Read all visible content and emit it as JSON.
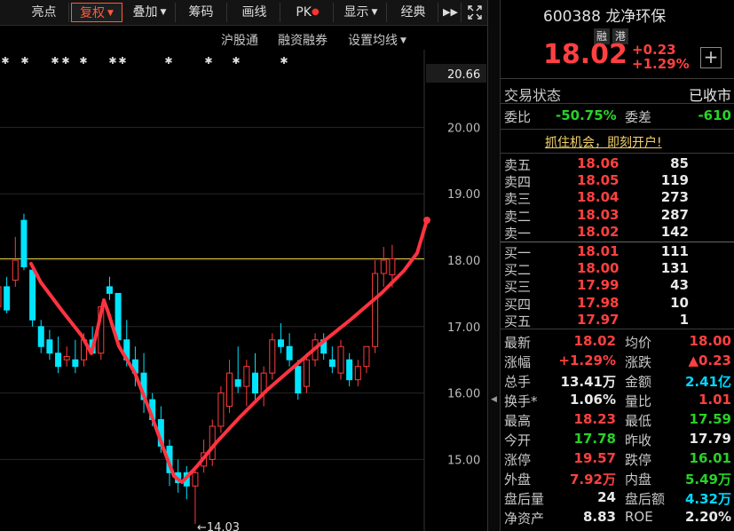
{
  "toolbar": {
    "items": [
      "亮点",
      "复权",
      "叠加",
      "筹码",
      "画线",
      "PK",
      "显示",
      "经典"
    ],
    "expand_icon": "double-chevron-right-icon",
    "fullscreen_icon": "fullscreen-icon"
  },
  "subbar": {
    "items": [
      "沪股通",
      "融资融券",
      "设置均线"
    ]
  },
  "axis": {
    "current_price_label": "20.66",
    "ticks": [
      {
        "value": 20.0,
        "label": "20.00"
      },
      {
        "value": 19.0,
        "label": "19.00"
      },
      {
        "value": 18.0,
        "label": "18.00"
      },
      {
        "value": 17.0,
        "label": "17.00"
      },
      {
        "value": 16.0,
        "label": "16.00"
      },
      {
        "value": 15.0,
        "label": "15.00"
      }
    ],
    "low_marker": "←14.03",
    "ref_line": 18.02
  },
  "colors": {
    "up": "#ff3c3c",
    "down": "#00e5ff",
    "annotation": "#ff3340",
    "ref": "#e6c84a"
  },
  "stock": {
    "code": "600388",
    "name": "龙净环保",
    "tags": [
      "融",
      "港"
    ],
    "price": "18.02",
    "change": "+0.23",
    "change_pct": "+1.29%",
    "add_icon": "plus-box-icon"
  },
  "status": {
    "label": "交易状态",
    "value": "已收市"
  },
  "wei": {
    "ratio_label": "委比",
    "ratio_value": "-50.75%",
    "diff_label": "委差",
    "diff_value": "-610"
  },
  "promo": "抓住机会，即刻开户!",
  "asks": [
    {
      "label": "卖五",
      "price": "18.06",
      "vol": "85"
    },
    {
      "label": "卖四",
      "price": "18.05",
      "vol": "119"
    },
    {
      "label": "卖三",
      "price": "18.04",
      "vol": "273"
    },
    {
      "label": "卖二",
      "price": "18.03",
      "vol": "287"
    },
    {
      "label": "卖一",
      "price": "18.02",
      "vol": "142"
    }
  ],
  "bids": [
    {
      "label": "买一",
      "price": "18.01",
      "vol": "111"
    },
    {
      "label": "买二",
      "price": "18.00",
      "vol": "131"
    },
    {
      "label": "买三",
      "price": "17.99",
      "vol": "43"
    },
    {
      "label": "买四",
      "price": "17.98",
      "vol": "10"
    },
    {
      "label": "买五",
      "price": "17.97",
      "vol": "1"
    }
  ],
  "stats": [
    {
      "l1": "最新",
      "v1": "18.02",
      "c1": "red",
      "l2": "均价",
      "v2": "18.00",
      "c2": "red"
    },
    {
      "l1": "涨幅",
      "v1": "+1.29%",
      "c1": "red",
      "l2": "涨跌",
      "v2": "▲0.23",
      "c2": "red"
    },
    {
      "l1": "总手",
      "v1": "13.41万",
      "c1": "white",
      "l2": "金额",
      "v2": "2.41亿",
      "c2": "cyan"
    },
    {
      "l1": "换手*",
      "v1": "1.06%",
      "c1": "white",
      "l2": "量比",
      "v2": "1.01",
      "c2": "red"
    },
    {
      "l1": "最高",
      "v1": "18.23",
      "c1": "red",
      "l2": "最低",
      "v2": "17.59",
      "c2": "green"
    },
    {
      "l1": "今开",
      "v1": "17.78",
      "c1": "green",
      "l2": "昨收",
      "v2": "17.79",
      "c2": "white"
    },
    {
      "l1": "涨停",
      "v1": "19.57",
      "c1": "red",
      "l2": "跌停",
      "v2": "16.01",
      "c2": "green"
    },
    {
      "l1": "外盘",
      "v1": "7.92万",
      "c1": "red",
      "l2": "内盘",
      "v2": "5.49万",
      "c2": "green"
    },
    {
      "l1": "盘后量",
      "v1": "24",
      "c1": "white",
      "l2": "盘后额",
      "v2": "4.32万",
      "c2": "cyan"
    },
    {
      "l1": "净资产",
      "v1": "8.83",
      "c1": "white",
      "l2": "ROE",
      "v2": "2.20%",
      "c2": "white"
    }
  ],
  "candles": [
    {
      "o": 17.3,
      "h": 17.7,
      "l": 17.1,
      "c": 17.6
    },
    {
      "o": 17.6,
      "h": 17.75,
      "l": 17.2,
      "c": 17.25
    },
    {
      "o": 17.7,
      "h": 18.35,
      "l": 17.6,
      "c": 18.0
    },
    {
      "o": 18.6,
      "h": 18.7,
      "l": 17.85,
      "c": 17.9
    },
    {
      "o": 17.85,
      "h": 17.95,
      "l": 17.0,
      "c": 17.1
    },
    {
      "o": 17.0,
      "h": 17.1,
      "l": 16.6,
      "c": 16.7
    },
    {
      "o": 16.8,
      "h": 16.95,
      "l": 16.5,
      "c": 16.6
    },
    {
      "o": 16.6,
      "h": 16.85,
      "l": 16.3,
      "c": 16.4
    },
    {
      "o": 16.5,
      "h": 16.7,
      "l": 16.4,
      "c": 16.55
    },
    {
      "o": 16.5,
      "h": 16.8,
      "l": 16.3,
      "c": 16.4
    },
    {
      "o": 16.5,
      "h": 16.9,
      "l": 16.4,
      "c": 16.8
    },
    {
      "o": 16.8,
      "h": 17.0,
      "l": 16.6,
      "c": 16.6
    },
    {
      "o": 16.6,
      "h": 17.3,
      "l": 16.5,
      "c": 17.3
    },
    {
      "o": 17.6,
      "h": 17.75,
      "l": 17.4,
      "c": 17.5
    },
    {
      "o": 17.5,
      "h": 17.5,
      "l": 16.7,
      "c": 16.8
    },
    {
      "o": 16.8,
      "h": 17.1,
      "l": 16.4,
      "c": 16.5
    },
    {
      "o": 16.5,
      "h": 16.7,
      "l": 16.1,
      "c": 16.3
    },
    {
      "o": 16.3,
      "h": 16.6,
      "l": 15.7,
      "c": 15.9
    },
    {
      "o": 15.9,
      "h": 16.0,
      "l": 15.5,
      "c": 15.6
    },
    {
      "o": 15.6,
      "h": 15.8,
      "l": 15.1,
      "c": 15.2
    },
    {
      "o": 15.2,
      "h": 15.3,
      "l": 14.6,
      "c": 14.8
    },
    {
      "o": 14.8,
      "h": 15.0,
      "l": 14.5,
      "c": 14.65
    },
    {
      "o": 14.8,
      "h": 14.9,
      "l": 14.4,
      "c": 14.6
    },
    {
      "o": 14.6,
      "h": 14.9,
      "l": 14.03,
      "c": 14.8
    },
    {
      "o": 14.9,
      "h": 15.3,
      "l": 14.8,
      "c": 15.1
    },
    {
      "o": 15.0,
      "h": 15.6,
      "l": 14.9,
      "c": 15.5
    },
    {
      "o": 15.5,
      "h": 16.1,
      "l": 15.4,
      "c": 16.0
    },
    {
      "o": 15.8,
      "h": 16.5,
      "l": 15.7,
      "c": 16.3
    },
    {
      "o": 16.2,
      "h": 16.7,
      "l": 16.0,
      "c": 16.1
    },
    {
      "o": 16.1,
      "h": 16.5,
      "l": 15.8,
      "c": 16.4
    },
    {
      "o": 16.3,
      "h": 16.6,
      "l": 15.9,
      "c": 16.0
    },
    {
      "o": 16.0,
      "h": 16.4,
      "l": 15.8,
      "c": 16.3
    },
    {
      "o": 16.3,
      "h": 16.9,
      "l": 16.2,
      "c": 16.8
    },
    {
      "o": 16.8,
      "h": 17.05,
      "l": 16.6,
      "c": 16.7
    },
    {
      "o": 16.7,
      "h": 16.9,
      "l": 16.4,
      "c": 16.5
    },
    {
      "o": 16.4,
      "h": 16.5,
      "l": 15.9,
      "c": 16.0
    },
    {
      "o": 16.1,
      "h": 16.6,
      "l": 16.0,
      "c": 16.5
    },
    {
      "o": 16.5,
      "h": 16.9,
      "l": 16.4,
      "c": 16.8
    },
    {
      "o": 16.8,
      "h": 16.9,
      "l": 16.5,
      "c": 16.6
    },
    {
      "o": 16.5,
      "h": 16.7,
      "l": 16.3,
      "c": 16.4
    },
    {
      "o": 16.3,
      "h": 16.8,
      "l": 16.2,
      "c": 16.7
    },
    {
      "o": 16.5,
      "h": 16.6,
      "l": 16.1,
      "c": 16.2
    },
    {
      "o": 16.2,
      "h": 16.5,
      "l": 16.1,
      "c": 16.4
    },
    {
      "o": 16.4,
      "h": 16.7,
      "l": 16.3,
      "c": 16.7
    },
    {
      "o": 16.7,
      "h": 18.0,
      "l": 16.6,
      "c": 17.8
    },
    {
      "o": 17.8,
      "h": 18.2,
      "l": 17.6,
      "c": 18.0
    },
    {
      "o": 17.78,
      "h": 18.23,
      "l": 17.59,
      "c": 18.02
    }
  ]
}
